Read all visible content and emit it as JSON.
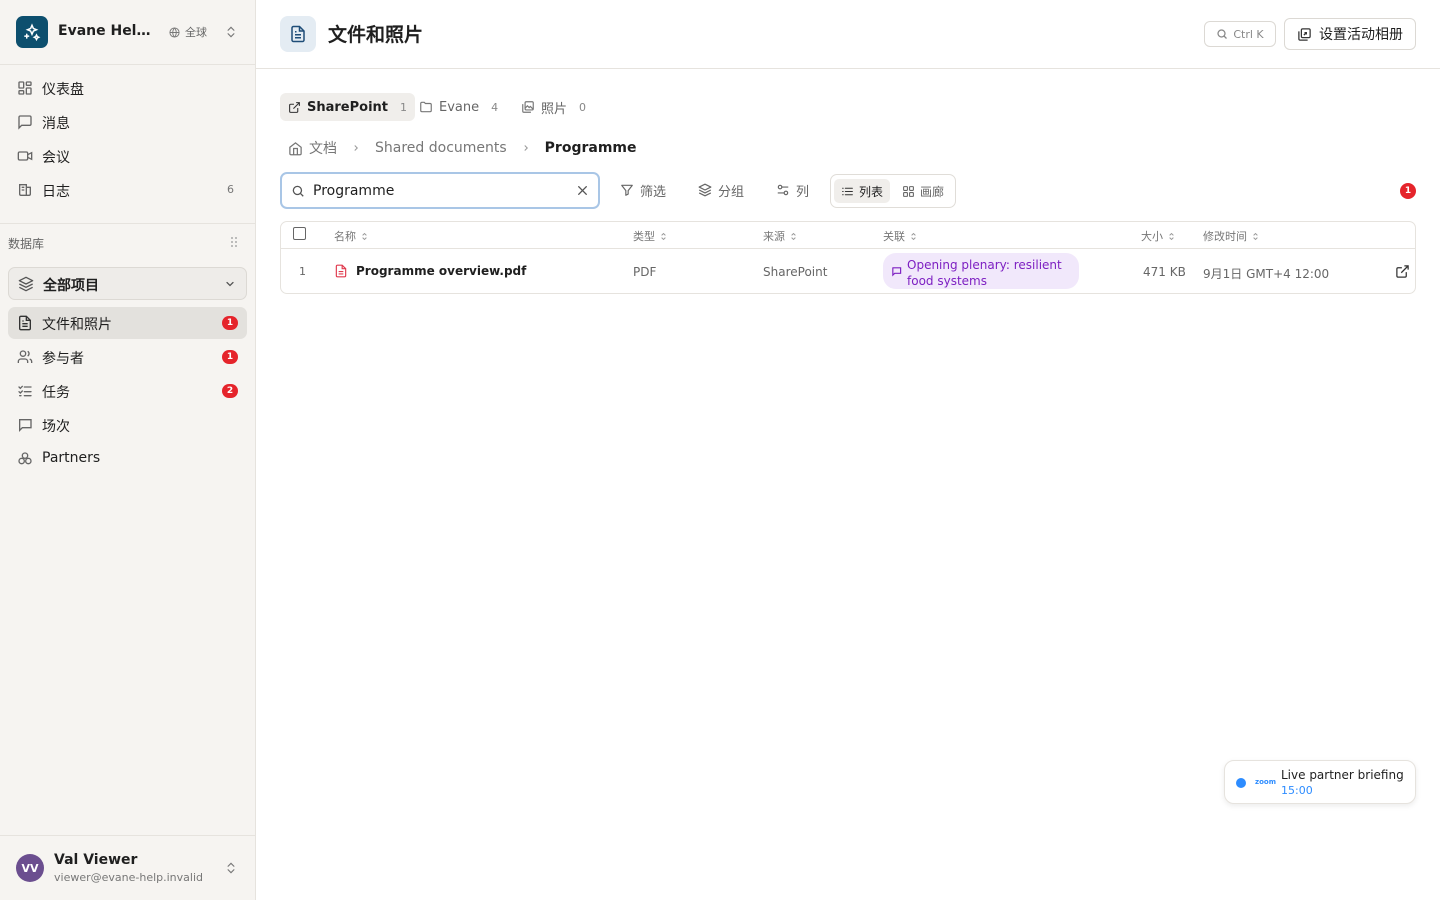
{
  "workspace": {
    "name": "Evane Help ...",
    "scope": "全球"
  },
  "nav": {
    "dashboard": "仪表盘",
    "messages": "消息",
    "meetings": "会议",
    "log": "日志",
    "log_count": "6"
  },
  "database": {
    "label": "数据库",
    "selected": "全部项目",
    "items": [
      {
        "label": "文件和照片",
        "badge": "1"
      },
      {
        "label": "参与者",
        "badge": "1"
      },
      {
        "label": "任务",
        "badge": "2"
      },
      {
        "label": "场次",
        "badge": ""
      },
      {
        "label": "Partners",
        "badge": ""
      }
    ]
  },
  "user": {
    "initials": "VV",
    "name": "Val Viewer",
    "email": "viewer@evane-help.invalid"
  },
  "header": {
    "title": "文件和照片",
    "shortcut": "Ctrl K",
    "album_button": "设置活动相册"
  },
  "sources": [
    {
      "label": "SharePoint",
      "count": "1"
    },
    {
      "label": "Evane",
      "count": "4"
    },
    {
      "label": "照片",
      "count": "0"
    }
  ],
  "breadcrumb": [
    "文档",
    "Shared documents",
    "Programme"
  ],
  "toolbar": {
    "search_value": "Programme",
    "filter": "筛选",
    "group": "分组",
    "columns": "列",
    "view_list": "列表",
    "view_gallery": "画廊",
    "notification_count": "1"
  },
  "table": {
    "headers": [
      "名称",
      "类型",
      "来源",
      "关联",
      "大小",
      "修改时间"
    ],
    "rows": [
      {
        "index": "1",
        "name": "Programme overview.pdf",
        "type": "PDF",
        "source": "SharePoint",
        "relation": "Opening plenary: resilient food systems",
        "size": "471 KB",
        "modified": "9月1日 GMT+4 12:00"
      }
    ]
  },
  "toast": {
    "brand": "zoom",
    "title": "Live partner briefing",
    "time": "15:00"
  },
  "colors": {
    "accent": "#0d4f6e",
    "badge": "#e5242b",
    "relation": "#7d1fc2",
    "zoom": "#2d8cff"
  }
}
